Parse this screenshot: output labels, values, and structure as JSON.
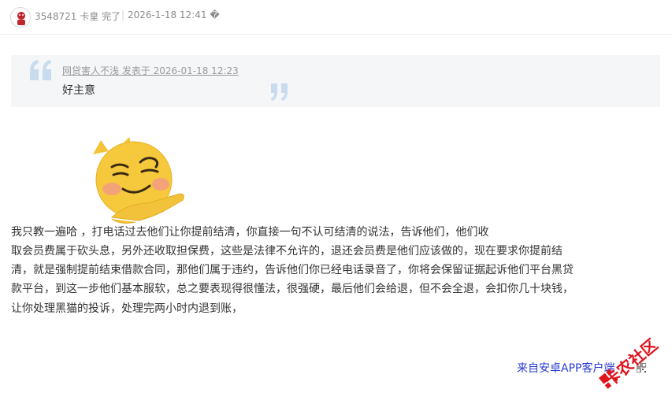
{
  "header": {
    "user_id": "3548721",
    "user_title": "卡皇 完了",
    "separator": "|",
    "timestamp": "2026-1-18 12:41 �",
    "avatar_icon": "user-avatar-icon"
  },
  "quote": {
    "meta": "网贷害人不浅 发表于 2026-01-18 12:23",
    "text": "好主意",
    "accent_color": "#c9dcee"
  },
  "post": {
    "lines": [
      "我只教一遍哈                                 ，打电话过去他们让你提前结清，你直接一句不认可结清的说法，告诉他们，他们收",
      "取会员费属于砍头息，另外还收取担保费，这些是法律不允许的，退还会员费是他们应该做的，现在要求你提前结",
      "清，就是强制提前结束借款合同，那他们属于违约，告诉他们你已经电话录音了，你将会保留证据起诉他们平台黑贷",
      "款平台，到这一步他们基本服软，总之要表现得很懂法，很强硬，最后他们会给退，但不会全退，会扣你几十块钱，",
      "让你处理黑猫的投诉，处理完两小时内退到账，"
    ],
    "emoji_icon": "smirk-emoji-icon"
  },
  "footer": {
    "client_link": "来自安卓APP客户端",
    "qr_icon": "qr-code-icon",
    "link_color": "#2a3bd1"
  },
  "watermark": {
    "text": "卡农社区",
    "color": "#e0141e"
  }
}
